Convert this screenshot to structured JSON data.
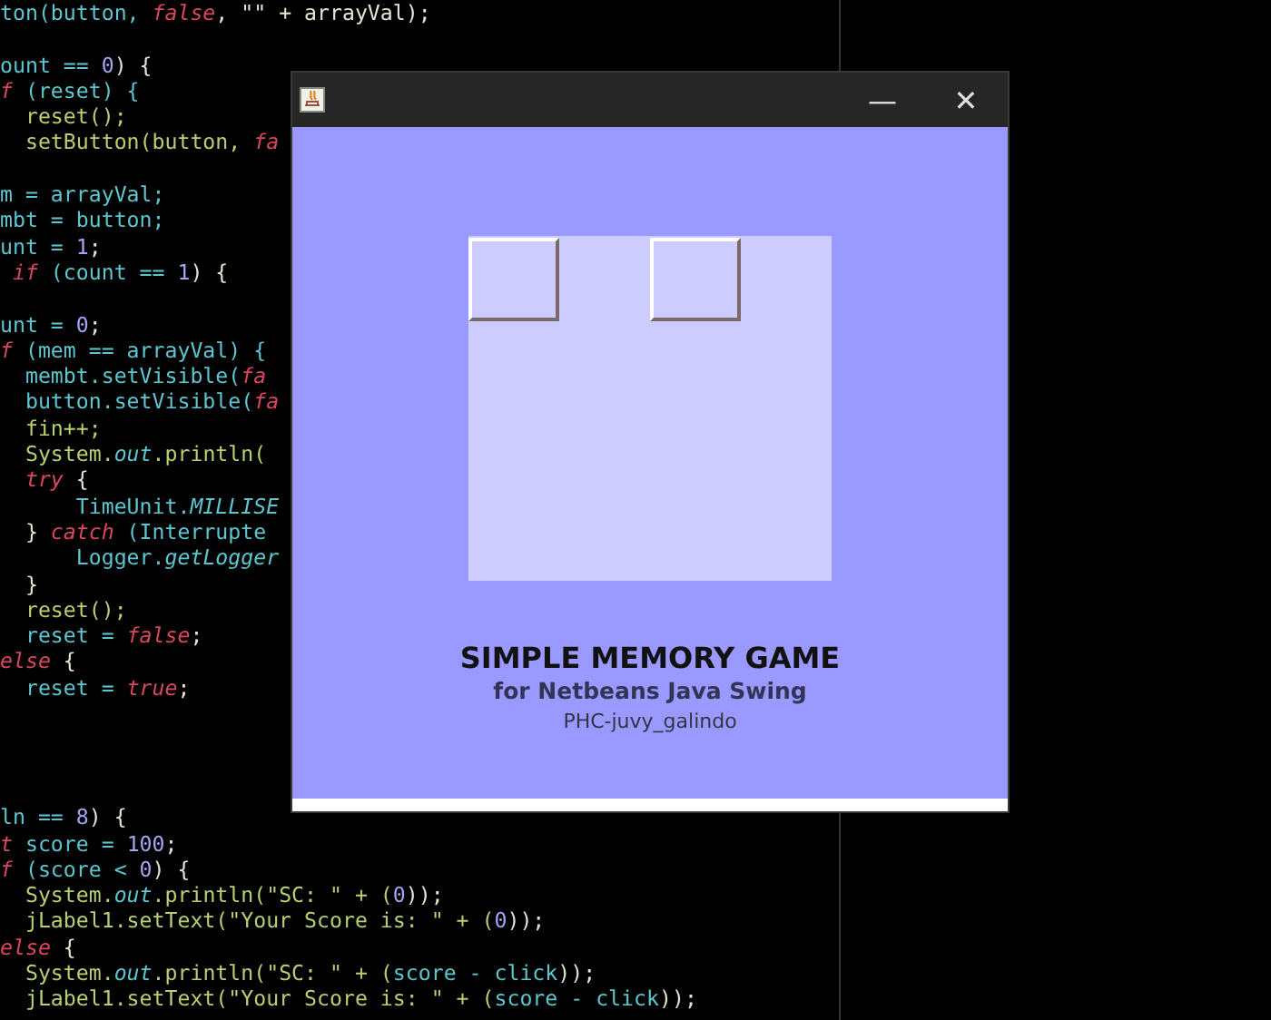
{
  "editor": {
    "lines": [
      {
        "kind": "code",
        "segments": [
          {
            "text": "ton(button, ",
            "kind": "id"
          },
          {
            "text": "false",
            "kind": "kw"
          },
          {
            "text": ", \"\" + arrayVal);",
            "kind": "pun"
          }
        ]
      },
      {
        "kind": "blank"
      },
      {
        "kind": "code",
        "segments": [
          {
            "text": "ount == ",
            "kind": "id"
          },
          {
            "text": "0",
            "kind": "num"
          },
          {
            "text": ") {",
            "kind": "pun"
          }
        ]
      },
      {
        "kind": "code",
        "segments": [
          {
            "text": "f",
            "kind": "kw"
          },
          {
            "text": " (reset) {",
            "kind": "id"
          }
        ]
      },
      {
        "kind": "code",
        "segments": [
          {
            "text": "  reset();",
            "kind": "call"
          }
        ]
      },
      {
        "kind": "code",
        "segments": [
          {
            "text": "  setButton(button, ",
            "kind": "call"
          },
          {
            "text": "fa",
            "kind": "kw"
          }
        ]
      },
      {
        "kind": "blank"
      },
      {
        "kind": "code",
        "segments": [
          {
            "text": "m = arrayVal;",
            "kind": "id"
          }
        ]
      },
      {
        "kind": "code",
        "segments": [
          {
            "text": "mbt = button;",
            "kind": "id"
          }
        ]
      },
      {
        "kind": "code",
        "segments": [
          {
            "text": "unt = ",
            "kind": "id"
          },
          {
            "text": "1",
            "kind": "num"
          },
          {
            "text": ";",
            "kind": "pun"
          }
        ]
      },
      {
        "kind": "code",
        "segments": [
          {
            "text": " if",
            "kind": "kw"
          },
          {
            "text": " (count == ",
            "kind": "id"
          },
          {
            "text": "1",
            "kind": "num"
          },
          {
            "text": ") {",
            "kind": "pun"
          }
        ]
      },
      {
        "kind": "blank"
      },
      {
        "kind": "code",
        "segments": [
          {
            "text": "unt = ",
            "kind": "id"
          },
          {
            "text": "0",
            "kind": "num"
          },
          {
            "text": ";",
            "kind": "pun"
          }
        ]
      },
      {
        "kind": "code",
        "segments": [
          {
            "text": "f",
            "kind": "kw"
          },
          {
            "text": " (mem == arrayVal) {",
            "kind": "id"
          }
        ]
      },
      {
        "kind": "code",
        "segments": [
          {
            "text": "  membt.setVisible(",
            "kind": "id"
          },
          {
            "text": "fa",
            "kind": "kw"
          }
        ]
      },
      {
        "kind": "code",
        "segments": [
          {
            "text": "  button.setVisible(",
            "kind": "id"
          },
          {
            "text": "fa",
            "kind": "kw"
          }
        ]
      },
      {
        "kind": "code",
        "segments": [
          {
            "text": "  fin++;",
            "kind": "call"
          }
        ]
      },
      {
        "kind": "code",
        "segments": [
          {
            "text": "  System.",
            "kind": "call"
          },
          {
            "text": "out",
            "kind": "fld"
          },
          {
            "text": ".println(",
            "kind": "call"
          }
        ]
      },
      {
        "kind": "code",
        "segments": [
          {
            "text": "  try",
            "kind": "kw"
          },
          {
            "text": " {",
            "kind": "pun"
          }
        ]
      },
      {
        "kind": "code",
        "segments": [
          {
            "text": "      TimeUnit.",
            "kind": "id"
          },
          {
            "text": "MILLISE",
            "kind": "fld"
          }
        ]
      },
      {
        "kind": "code",
        "segments": [
          {
            "text": "  } ",
            "kind": "pun"
          },
          {
            "text": "catch",
            "kind": "kw"
          },
          {
            "text": " (Interrupte",
            "kind": "id"
          }
        ]
      },
      {
        "kind": "code",
        "segments": [
          {
            "text": "      Logger.",
            "kind": "id"
          },
          {
            "text": "getLogger",
            "kind": "fld"
          }
        ]
      },
      {
        "kind": "code",
        "segments": [
          {
            "text": "  }",
            "kind": "pun"
          }
        ]
      },
      {
        "kind": "code",
        "segments": [
          {
            "text": "  reset();",
            "kind": "call"
          }
        ]
      },
      {
        "kind": "code",
        "segments": [
          {
            "text": "  reset = ",
            "kind": "id"
          },
          {
            "text": "false",
            "kind": "kw"
          },
          {
            "text": ";",
            "kind": "pun"
          }
        ]
      },
      {
        "kind": "code",
        "segments": [
          {
            "text": "else",
            "kind": "kw"
          },
          {
            "text": " {",
            "kind": "pun"
          }
        ]
      },
      {
        "kind": "code",
        "segments": [
          {
            "text": "  reset = ",
            "kind": "id"
          },
          {
            "text": "true",
            "kind": "kw"
          },
          {
            "text": ";",
            "kind": "pun"
          }
        ]
      },
      {
        "kind": "blank"
      },
      {
        "kind": "blank"
      },
      {
        "kind": "blank"
      },
      {
        "kind": "blank"
      },
      {
        "kind": "code",
        "segments": [
          {
            "text": "ln == ",
            "kind": "id"
          },
          {
            "text": "8",
            "kind": "num"
          },
          {
            "text": ") {",
            "kind": "pun"
          }
        ]
      },
      {
        "kind": "code",
        "segments": [
          {
            "text": "t",
            "kind": "kw"
          },
          {
            "text": " score = ",
            "kind": "id"
          },
          {
            "text": "100",
            "kind": "num"
          },
          {
            "text": ";",
            "kind": "pun"
          }
        ]
      },
      {
        "kind": "code",
        "segments": [
          {
            "text": "f",
            "kind": "kw"
          },
          {
            "text": " (score < ",
            "kind": "id"
          },
          {
            "text": "0",
            "kind": "num"
          },
          {
            "text": ") {",
            "kind": "pun"
          }
        ]
      },
      {
        "kind": "code",
        "segments": [
          {
            "text": "  System.",
            "kind": "call"
          },
          {
            "text": "out",
            "kind": "fld"
          },
          {
            "text": ".println(\"SC: \" + (",
            "kind": "call"
          },
          {
            "text": "0",
            "kind": "num"
          },
          {
            "text": "));",
            "kind": "pun"
          }
        ]
      },
      {
        "kind": "code",
        "segments": [
          {
            "text": "  jLabel1.setText(\"Your Score is: \" + (",
            "kind": "call"
          },
          {
            "text": "0",
            "kind": "num"
          },
          {
            "text": "));",
            "kind": "pun"
          }
        ]
      },
      {
        "kind": "code",
        "segments": [
          {
            "text": "else",
            "kind": "kw"
          },
          {
            "text": " {",
            "kind": "pun"
          }
        ]
      },
      {
        "kind": "code",
        "segments": [
          {
            "text": "  System.",
            "kind": "call"
          },
          {
            "text": "out",
            "kind": "fld"
          },
          {
            "text": ".println(\"SC: \" + (",
            "kind": "call"
          },
          {
            "text": "score - click",
            "kind": "id"
          },
          {
            "text": "));",
            "kind": "pun"
          }
        ]
      },
      {
        "kind": "code",
        "segments": [
          {
            "text": "  jLabel1.setText(\"Your Score is: \" + (",
            "kind": "call"
          },
          {
            "text": "score - click",
            "kind": "id"
          },
          {
            "text": "));",
            "kind": "pun"
          }
        ]
      }
    ]
  },
  "window": {
    "minimize_glyph": "—",
    "close_glyph": "✕",
    "board": {
      "tiles": [
        {
          "visible": true
        },
        {
          "visible": false
        },
        {
          "visible": true
        },
        {
          "visible": false
        },
        {
          "visible": false
        },
        {
          "visible": false
        },
        {
          "visible": false
        },
        {
          "visible": false
        },
        {
          "visible": false
        },
        {
          "visible": false
        },
        {
          "visible": false
        },
        {
          "visible": false
        },
        {
          "visible": false
        },
        {
          "visible": false
        },
        {
          "visible": false
        },
        {
          "visible": false
        }
      ]
    },
    "title": "SIMPLE MEMORY GAME",
    "subtitle": "for Netbeans Java Swing",
    "author": "PHC-juvy_galindo"
  }
}
